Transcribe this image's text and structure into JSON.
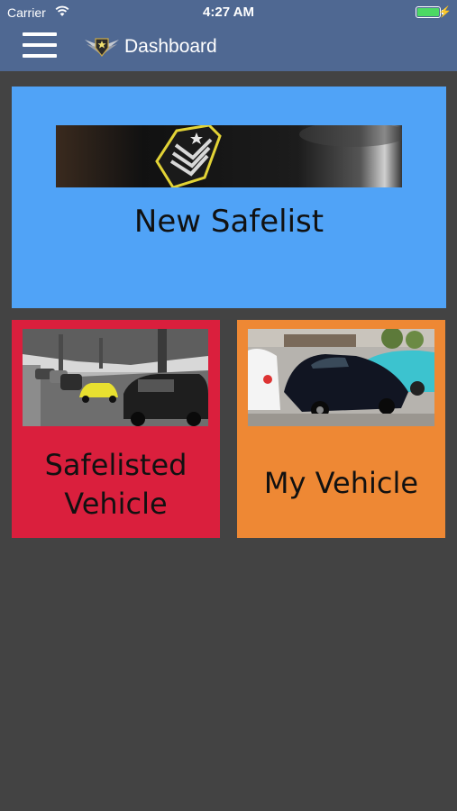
{
  "status_bar": {
    "carrier": "Carrier",
    "time": "4:27 AM",
    "battery_level": 1.0,
    "battery_color": "#4cd964"
  },
  "nav": {
    "title": "Dashboard",
    "menu_icon": "hamburger-menu-icon",
    "logo_icon": "winged-badge-logo-icon",
    "background": "#4f6892"
  },
  "tiles": {
    "new_safelist": {
      "label": "New Safelist",
      "color": "#50a3f7",
      "image": "sergeant-chevron-badge-photo"
    },
    "safelisted_vehicle": {
      "label_line1": "Safelisted",
      "label_line2": "Vehicle",
      "color": "#da1f3d",
      "image": "parked-cars-street-photo"
    },
    "my_vehicle": {
      "label": "My Vehicle",
      "color": "#ee8834",
      "image": "classic-corvette-car-show-photo"
    }
  },
  "page_background": "#434343"
}
